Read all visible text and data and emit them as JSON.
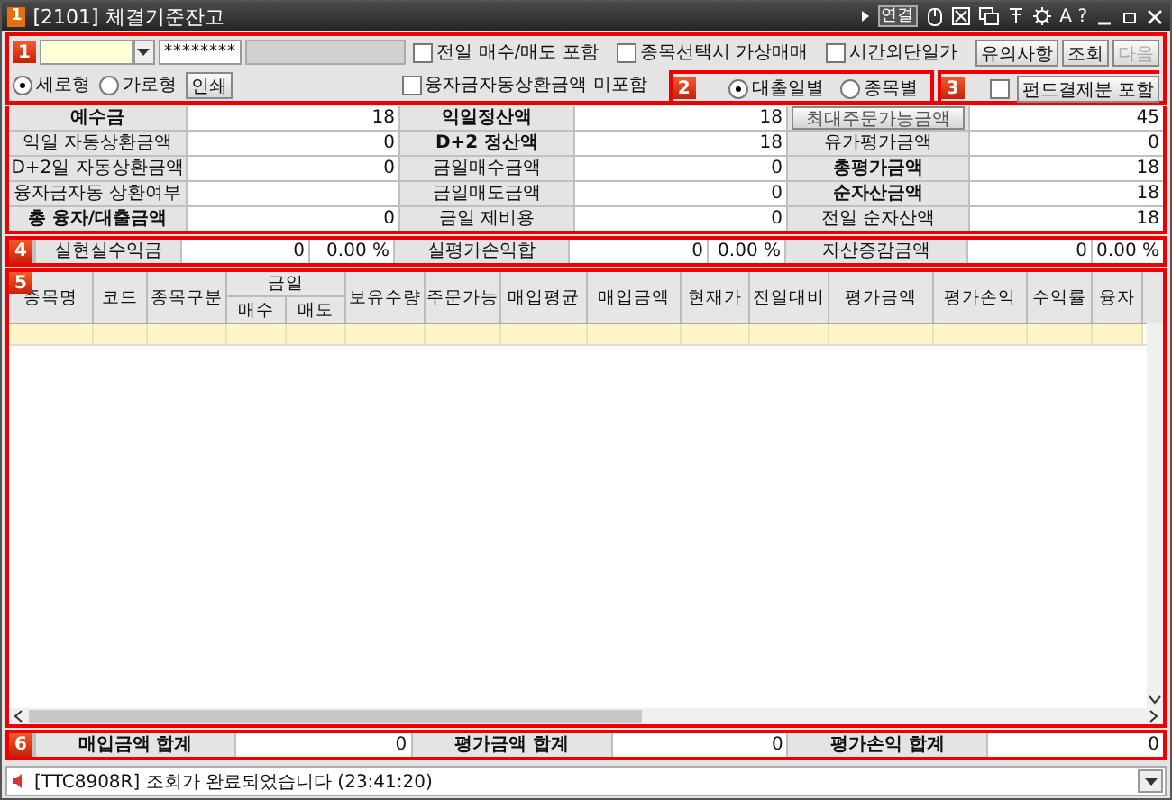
{
  "window": {
    "badge": "1",
    "title": "[2101] 체결기준잔고",
    "link_label": "연결",
    "help_label": "A ?"
  },
  "section1": {
    "badge": "1",
    "password": "********",
    "checks_row1": [
      {
        "label": "전일 매수/매도 포함",
        "checked": false
      },
      {
        "label": "종목선택시 가상매매",
        "checked": false
      },
      {
        "label": "시간외단일가",
        "checked": false
      }
    ],
    "buttons": [
      {
        "label": "유의사항",
        "disabled": false
      },
      {
        "label": "조회",
        "disabled": false
      },
      {
        "label": "다음",
        "disabled": true
      }
    ],
    "layout_radios": [
      {
        "label": "세로형",
        "selected": true
      },
      {
        "label": "가로형",
        "selected": false
      }
    ],
    "print_button": "인쇄",
    "check_row2": {
      "label": "융자금자동상환금액 미포함",
      "checked": false
    }
  },
  "section2": {
    "badge": "2",
    "radios": [
      {
        "label": "대출일별",
        "selected": true
      },
      {
        "label": "종목별",
        "selected": false
      }
    ]
  },
  "section3": {
    "badge": "3",
    "check": {
      "label": "펀드결제분 포함",
      "checked": false
    }
  },
  "summary": [
    [
      {
        "label": "예수금",
        "bold": true,
        "value": "18"
      },
      {
        "label": "익일정산액",
        "bold": true,
        "value": "18"
      },
      {
        "label": "최대주문가능금액",
        "bold": false,
        "kind": "button",
        "value": "45"
      }
    ],
    [
      {
        "label": "익일 자동상환금액",
        "bold": false,
        "value": "0"
      },
      {
        "label": "D+2 정산액",
        "bold": true,
        "value": "18"
      },
      {
        "label": "유가평가금액",
        "bold": false,
        "value": "0"
      }
    ],
    [
      {
        "label": "D+2일 자동상환금액",
        "bold": false,
        "value": "0"
      },
      {
        "label": "금일매수금액",
        "bold": false,
        "value": "0"
      },
      {
        "label": "총평가금액",
        "bold": true,
        "value": "18"
      }
    ],
    [
      {
        "label": "융자금자동 상환여부",
        "bold": false
      },
      {
        "label": "금일매도금액",
        "bold": false,
        "value": "0"
      },
      {
        "label": "순자산금액",
        "bold": true,
        "value": "18"
      }
    ],
    [
      {
        "label": "총 융자/대출금액",
        "bold": true,
        "value": "0"
      },
      {
        "label": "금일 제비용",
        "bold": false,
        "value": "0"
      },
      {
        "label": "전일 순자산액",
        "bold": false,
        "value": "18"
      }
    ]
  ],
  "section4": {
    "badge": "4",
    "items": [
      {
        "label": "실현실수익금",
        "value": "0",
        "percent": "0.00 %"
      },
      {
        "label": "실평가손익합",
        "value": "0",
        "percent": "0.00 %"
      },
      {
        "label": "자산증감금액",
        "value": "0",
        "percent": "0.00 %"
      }
    ]
  },
  "table": {
    "badge": "5",
    "columns": [
      {
        "label": "종목명"
      },
      {
        "label": "코드"
      },
      {
        "label": "종목구분"
      },
      {
        "label": "금일",
        "children": [
          {
            "label": "매수"
          },
          {
            "label": "매도"
          }
        ]
      },
      {
        "label": "보유수량"
      },
      {
        "label": "주문가능"
      },
      {
        "label": "매입평균"
      },
      {
        "label": "매입금액"
      },
      {
        "label": "현재가"
      },
      {
        "label": "전일대비"
      },
      {
        "label": "평가금액"
      },
      {
        "label": "평가손익"
      },
      {
        "label": "수익률"
      },
      {
        "label": "융자"
      }
    ]
  },
  "section6": {
    "badge": "6",
    "items": [
      {
        "label": "매입금액 합계",
        "value": "0"
      },
      {
        "label": "평가금액 합계",
        "value": "0"
      },
      {
        "label": "평가손익 합계",
        "value": "0"
      }
    ]
  },
  "status_bar": {
    "message": "[TTC8908R] 조회가 완료되었습니다 (23:41:20)"
  }
}
